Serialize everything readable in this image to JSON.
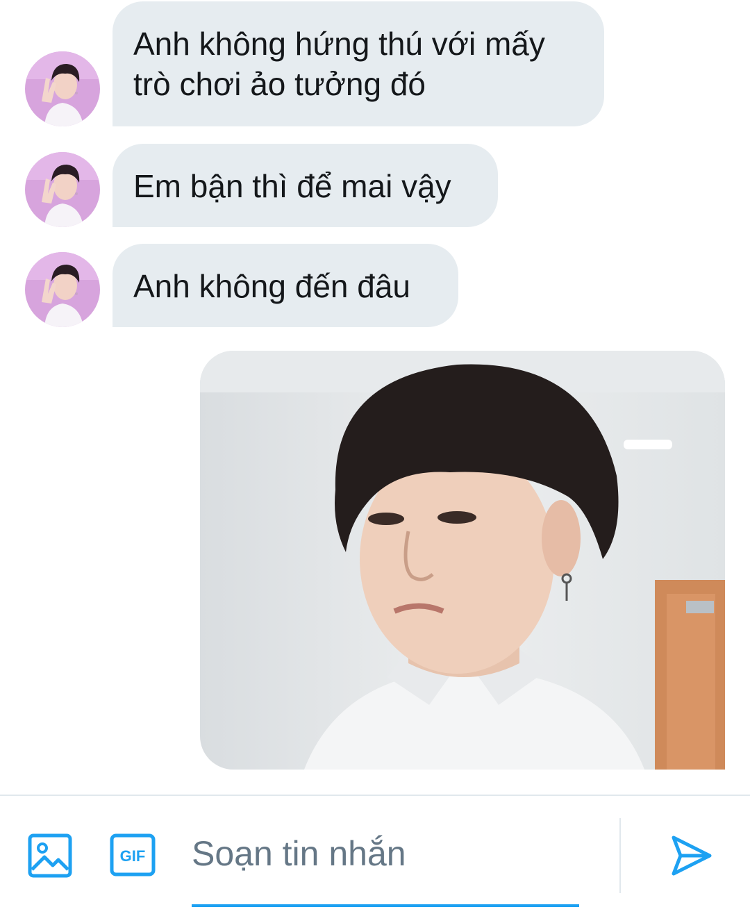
{
  "conversation": {
    "messages": [
      {
        "from": "other",
        "text": "Anh không hứng thú với mấy trò chơi ảo tưởng đó"
      },
      {
        "from": "other",
        "text": "Em bận thì để mai vậy"
      },
      {
        "from": "other",
        "text": "Anh không đến đâu"
      },
      {
        "from": "me",
        "type": "photo"
      }
    ]
  },
  "composer": {
    "placeholder": "Soạn tin nhắn",
    "icons": {
      "image": "image-icon",
      "gif": "gif-icon",
      "send": "send-icon"
    },
    "gif_label": "GIF"
  },
  "colors": {
    "accent": "#1da1f2",
    "bubble_received": "#e6ecf0",
    "text": "#14171a",
    "placeholder": "#657786",
    "divider": "#e1e8ed"
  }
}
